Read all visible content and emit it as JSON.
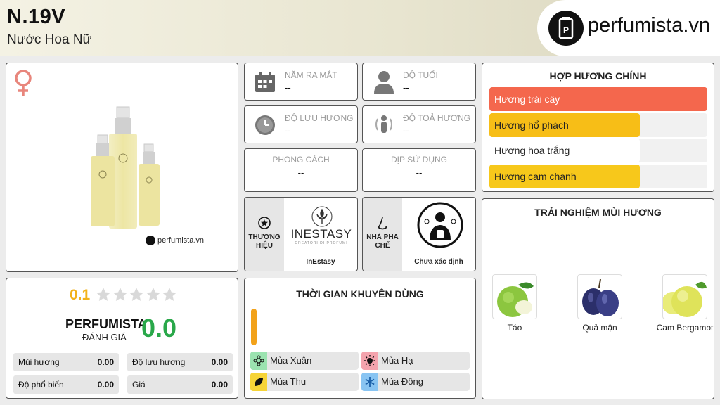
{
  "header": {
    "title": "N.19V",
    "subtitle": "Nước Hoa Nữ",
    "logo_text": "perfumista.vn"
  },
  "product": {
    "gender_icon": "female-symbol-icon",
    "brand_watermark": "INESTASY",
    "watermark": "perfumista.vn"
  },
  "info": {
    "release_year": {
      "label": "NĂM RA MẮT",
      "value": "--"
    },
    "age": {
      "label": "ĐỘ TUỔI",
      "value": "--"
    },
    "longevity": {
      "label": "ĐỘ LƯU HƯƠNG",
      "value": "--"
    },
    "sillage": {
      "label": "ĐỘ TOẢ HƯƠNG",
      "value": "--"
    },
    "style": {
      "label": "PHONG CÁCH",
      "value": "--"
    },
    "occasion": {
      "label": "DỊP SỬ DỤNG",
      "value": "--"
    }
  },
  "brand": {
    "label_line1": "THƯƠNG",
    "label_line2": "HIỆU",
    "logo_name": "INESTASY",
    "logo_tagline": "CREATORI DI PROFUMI",
    "name": "InEstasy"
  },
  "perfumer": {
    "label_line1": "NHÀ PHA",
    "label_line2": "CHẾ",
    "name": "Chưa xác định"
  },
  "accords": {
    "title": "HỢP HƯƠNG CHÍNH",
    "items": [
      {
        "label": "Hương trái cây",
        "level": 1.0,
        "color": "#f4674d",
        "text_color": "#ffffff"
      },
      {
        "label": "Hương hổ phách",
        "level": 0.69,
        "color": "#f7be17",
        "text_color": "#222222"
      },
      {
        "label": "Hương hoa trắng",
        "level": 0.69,
        "color": "#ffffff",
        "text_color": "#222222"
      },
      {
        "label": "Hương cam chanh",
        "level": 0.69,
        "color": "#f7c81b",
        "text_color": "#222222"
      }
    ]
  },
  "rating": {
    "user_score": "0.1",
    "stars_filled": 0,
    "stars_total": 5,
    "perfumista_label": "PERFUMISTA",
    "rating_label": "ĐÁNH GIÁ",
    "perfumista_score": "0.0",
    "stats": [
      {
        "name": "Mùi hương",
        "value": "0.00"
      },
      {
        "name": "Độ lưu hương",
        "value": "0.00"
      },
      {
        "name": "Độ phổ biến",
        "value": "0.00"
      },
      {
        "name": "Giá",
        "value": "0.00"
      }
    ]
  },
  "recommended_time": {
    "title": "THỜI GIAN KHUYÊN DÙNG",
    "seasons": [
      {
        "label": "Mùa Xuân",
        "icon": "flower-icon",
        "color": "#9be3b0"
      },
      {
        "label": "Mùa Hạ",
        "icon": "sun-icon",
        "color": "#f4a3ad"
      },
      {
        "label": "Mùa Thu",
        "icon": "leaf-icon",
        "color": "#f6d437"
      },
      {
        "label": "Mùa Đông",
        "icon": "snowflake-icon",
        "color": "#88c4f2"
      }
    ]
  },
  "notes": {
    "title": "TRẢI NGHIỆM MÙI HƯƠNG",
    "items": [
      {
        "name": "Táo",
        "icon": "apple-icon"
      },
      {
        "name": "Quả mận",
        "icon": "plum-icon"
      },
      {
        "name": "Cam Bergamot",
        "icon": "bergamot-icon"
      }
    ]
  },
  "colors": {
    "gold": "#f2b21a",
    "green": "#2aa84a",
    "orange_bar": "#f2a21a"
  }
}
